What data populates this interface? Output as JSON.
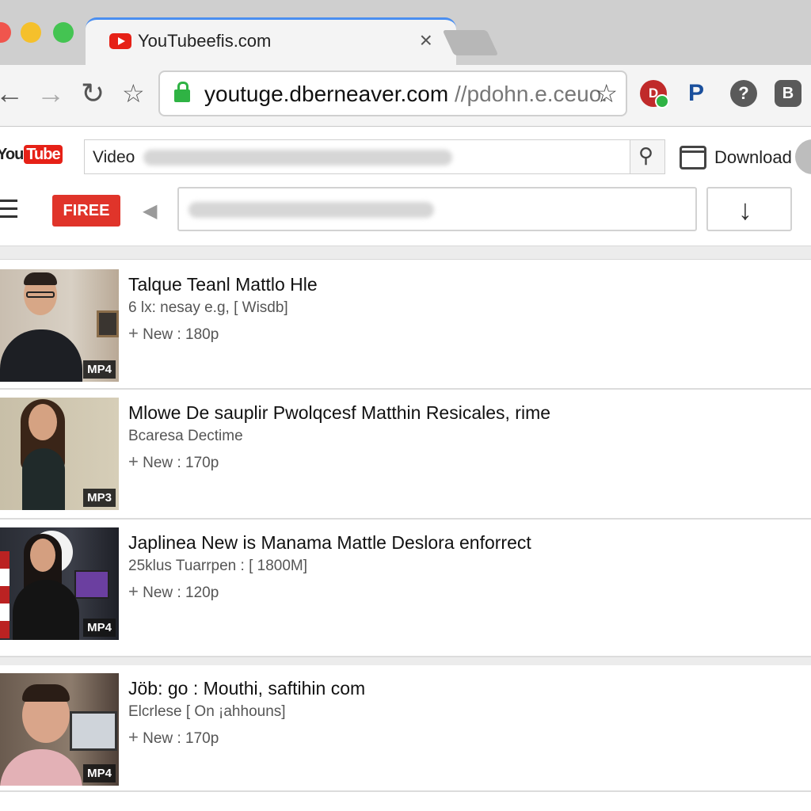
{
  "window": {
    "tab_title": "YouTubeefis.com",
    "tab_close": "×"
  },
  "toolbar": {
    "back": "←",
    "forward": "→",
    "reload": "↻",
    "bookmark": "☆",
    "url_main": "youtuge.dberneaver.com",
    "url_rest": " //pdohn.e.ceuo.",
    "star": "☆",
    "ext_d": "D",
    "ext_p": "P",
    "ext_help": "?",
    "ext_b": "B"
  },
  "page": {
    "logo_you": "You",
    "logo_tube": "Tube",
    "search_label": "Video",
    "search_icon": "⚲",
    "download_label": "Download",
    "menu_icon": "☰",
    "free_label": "FIREE",
    "speaker_icon": "◀",
    "download_arrow": "↓"
  },
  "videos": [
    {
      "title": "Talque Teanl Mattlo Hle",
      "meta": "6 lx: nesay e.g, [ Wisdb]",
      "plus": "+",
      "status": "New",
      "sep": ":",
      "quality": "180p",
      "format": "MP4"
    },
    {
      "title": "Mlowe De sauplir Pwolqcesf Matthin Resicales, rime",
      "meta": "Bcaresa Dectime",
      "plus": "+",
      "status": "New",
      "sep": ":",
      "quality": "170p",
      "format": "MP3"
    },
    {
      "title": "Japlinea New is Manama Mattle Deslora enforrect",
      "meta": "25klus Tuarrpen : [ 1800M]",
      "plus": "+",
      "status": "New",
      "sep": ":",
      "quality": "120p",
      "format": "MP4"
    },
    {
      "title": "Jöb: go : Mouthi, saftihin com",
      "meta": "Elcrlese [ On ¡ahhouns]",
      "plus": "+",
      "status": "New",
      "sep": ":",
      "quality": "170p",
      "format": "MP4"
    }
  ],
  "colors": {
    "accent": "#e62117",
    "free_button": "#e0342a",
    "tab_highlight": "#4a8ef0",
    "lock": "#2fb344"
  }
}
